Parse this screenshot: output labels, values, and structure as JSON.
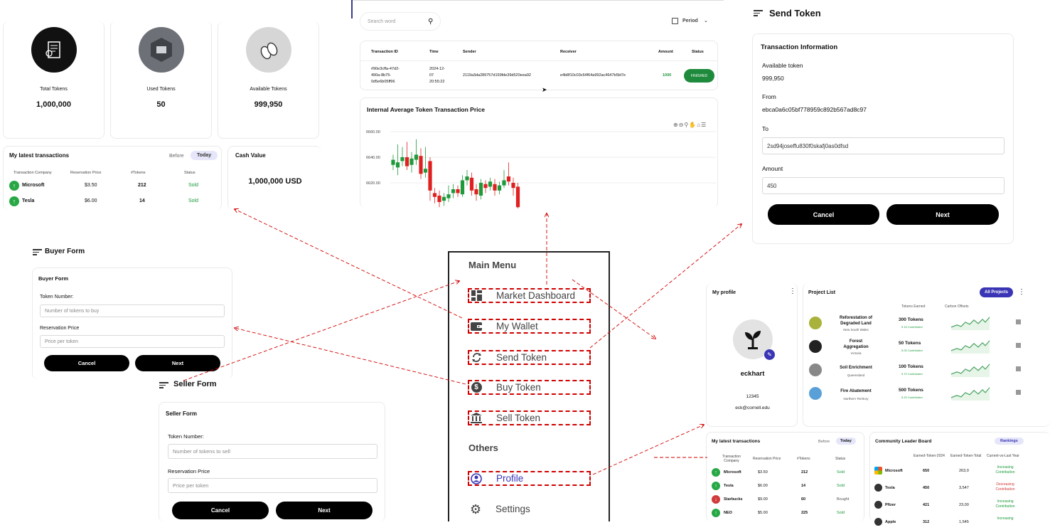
{
  "summary": {
    "tiles": [
      {
        "label": "Total Tokens",
        "value": "1,000,000"
      },
      {
        "label": "Used Tokens",
        "value": "50"
      },
      {
        "label": "Available Tokens",
        "value": "999,950"
      }
    ],
    "latest": {
      "title": "My latest transactions",
      "tabs": [
        "Before",
        "Today"
      ],
      "headers": [
        "Transaction Company",
        "Reservation Price",
        "#Tokens",
        "Status"
      ],
      "rows": [
        {
          "company": "Microsoft",
          "price": "$3.50",
          "tokens": "212",
          "status": "Sold"
        },
        {
          "company": "Tesla",
          "price": "$6.00",
          "tokens": "14",
          "status": "Sold"
        }
      ]
    },
    "cash": {
      "title": "Cash Value",
      "value": "1,000,000 USD"
    }
  },
  "market": {
    "search_placeholder": "Search word",
    "period_label": "Period",
    "table_headers": [
      "Transaction ID",
      "Time",
      "Sender",
      "Receiver",
      "Amount",
      "Status"
    ],
    "row": {
      "id": [
        "#90e3cffa-47d2-",
        "490a-8b75-",
        "0d5e6b05ff96"
      ],
      "time": [
        "2024-12-",
        "07",
        "20:55:22"
      ],
      "sender": "2119a3da289757d159fde39d520eea92",
      "receiver": "e4b8f10c03c64f64a992ac4647b5bl7e",
      "amount": "1000",
      "status": "FINISHED"
    },
    "chart_title": "Internal Average Token Transaction Price"
  },
  "chart_data": {
    "type": "candlestick",
    "title": "Internal Average Token Transaction Price",
    "y_ticks": [
      "6660.00",
      "6640.00",
      "6620.00"
    ],
    "ylim": [
      6600,
      6665
    ],
    "candles": [
      {
        "o": 6634,
        "c": 6638,
        "h": 6642,
        "l": 6630
      },
      {
        "o": 6632,
        "c": 6636,
        "h": 6650,
        "l": 6626
      },
      {
        "o": 6637,
        "c": 6640,
        "h": 6648,
        "l": 6633
      },
      {
        "o": 6640,
        "c": 6633,
        "h": 6652,
        "l": 6630
      },
      {
        "o": 6634,
        "c": 6639,
        "h": 6644,
        "l": 6628
      },
      {
        "o": 6638,
        "c": 6642,
        "h": 6654,
        "l": 6634
      },
      {
        "o": 6641,
        "c": 6627,
        "h": 6647,
        "l": 6623
      },
      {
        "o": 6628,
        "c": 6631,
        "h": 6648,
        "l": 6624
      },
      {
        "o": 6637,
        "c": 6614,
        "h": 6640,
        "l": 6606
      },
      {
        "o": 6612,
        "c": 6609,
        "h": 6616,
        "l": 6604
      },
      {
        "o": 6610,
        "c": 6605,
        "h": 6614,
        "l": 6601
      },
      {
        "o": 6606,
        "c": 6609,
        "h": 6612,
        "l": 6602
      },
      {
        "o": 6608,
        "c": 6611,
        "h": 6618,
        "l": 6605
      },
      {
        "o": 6612,
        "c": 6615,
        "h": 6619,
        "l": 6608
      },
      {
        "o": 6615,
        "c": 6612,
        "h": 6618,
        "l": 6609
      },
      {
        "o": 6611,
        "c": 6622,
        "h": 6626,
        "l": 6609
      },
      {
        "o": 6622,
        "c": 6625,
        "h": 6630,
        "l": 6618
      },
      {
        "o": 6624,
        "c": 6614,
        "h": 6628,
        "l": 6610
      },
      {
        "o": 6615,
        "c": 6611,
        "h": 6619,
        "l": 6606
      },
      {
        "o": 6610,
        "c": 6620,
        "h": 6623,
        "l": 6607
      },
      {
        "o": 6619,
        "c": 6616,
        "h": 6622,
        "l": 6612
      },
      {
        "o": 6617,
        "c": 6621,
        "h": 6624,
        "l": 6614
      },
      {
        "o": 6619,
        "c": 6614,
        "h": 6623,
        "l": 6610
      },
      {
        "o": 6614,
        "c": 6618,
        "h": 6621,
        "l": 6611
      },
      {
        "o": 6618,
        "c": 6622,
        "h": 6630,
        "l": 6616
      },
      {
        "o": 6625,
        "c": 6621,
        "h": 6636,
        "l": 6618
      },
      {
        "o": 6620,
        "c": 6616,
        "h": 6624,
        "l": 6610
      },
      {
        "o": 6617,
        "c": 6601,
        "h": 6620,
        "l": 6600
      }
    ]
  },
  "send": {
    "title": "Send Token",
    "section": "Transaction Information",
    "available_label": "Available token",
    "available_value": "999,950",
    "from_label": "From",
    "from_value": "ebca0a6c05bf778959c892b567ad8c97",
    "to_label": "To",
    "to_value": "2sd94joseffu830f0skafj0as0dfsd",
    "amount_label": "Amount",
    "amount_value": "450",
    "cancel": "Cancel",
    "next": "Next"
  },
  "buyer": {
    "title": "Buyer Form",
    "section": "Buyer Form",
    "token_label": "Token Number:",
    "token_placeholder": "Number of tokens to buy",
    "price_label": "Reservation Price",
    "price_placeholder": "Price per token",
    "cancel": "Cancel",
    "next": "Next"
  },
  "seller": {
    "title": "Seller Form",
    "section": "Seller Form",
    "token_label": "Token Number:",
    "token_placeholder": "Number of tokens to sell",
    "price_label": "Reservation Price",
    "price_placeholder": "Price per token",
    "cancel": "Cancel",
    "next": "Next"
  },
  "menu": {
    "main_title": "Main Menu",
    "items": [
      {
        "label": "Market Dashboard",
        "icon": "dashboard-icon"
      },
      {
        "label": "My Wallet",
        "icon": "wallet-icon"
      },
      {
        "label": "Send Token",
        "icon": "exchange-icon"
      },
      {
        "label": "Buy Token",
        "icon": "dollar-icon"
      },
      {
        "label": "Sell Token",
        "icon": "bank-icon"
      }
    ],
    "others_title": "Others",
    "profile": "Profile",
    "settings": "Settings"
  },
  "profile": {
    "title": "My profile",
    "name": "eckhart",
    "id": "12345",
    "email": "eck@cornell.edu",
    "projects_title": "Project List",
    "all_projects": "All Projects",
    "col_tokens": "Tokens Earned",
    "col_offsets": "Carbon Offsets",
    "projects": [
      {
        "name": [
          "Reforestation of",
          "Degraded Land"
        ],
        "region": "New South Wales",
        "tokens": "300 Tokens",
        "contrib": "5.15 Contributed"
      },
      {
        "name": [
          "Forest",
          "Aggregation"
        ],
        "region": "Victoria",
        "tokens": "50 Tokens",
        "contrib": "5.00 Contributed"
      },
      {
        "name": [
          "Soil Enrichment"
        ],
        "region": "Queensland",
        "tokens": "100 Tokens",
        "contrib": "5.70 Contributed"
      },
      {
        "name": [
          "Fire Abatement"
        ],
        "region": "Northern Territory",
        "tokens": "500 Tokens",
        "contrib": "5.20 Contributed"
      }
    ],
    "latest": {
      "title": "My latest transactions",
      "tabs": [
        "Before",
        "Today"
      ],
      "headers": [
        "Transaction Company",
        "Reservation Price",
        "#Tokens",
        "Status"
      ],
      "rows": [
        {
          "company": "Microsoft",
          "price": "$3.50",
          "tokens": "212",
          "status": "Sold"
        },
        {
          "company": "Tesla",
          "price": "$6.00",
          "tokens": "14",
          "status": "Sold"
        },
        {
          "company": "Starbucks",
          "price": "$9.00",
          "tokens": "60",
          "status": "Bought"
        },
        {
          "company": "NEO",
          "price": "$5.00",
          "tokens": "225",
          "status": "Sold"
        }
      ]
    },
    "leader": {
      "title": "Community Leader Board",
      "rankings": "Rankings",
      "headers": [
        "Earned-Token-2024",
        "Earned-Token-Total",
        "Current-vs-Last Year"
      ],
      "rows": [
        {
          "company": "Microsoft",
          "earned": "650",
          "total": "263,0",
          "trend": [
            "Increasing",
            "Contribution"
          ],
          "up": true
        },
        {
          "company": "Tesla",
          "earned": "450",
          "total": "3,547",
          "trend": [
            "Decreasing",
            "Contribution"
          ],
          "up": false
        },
        {
          "company": "Pfizer",
          "earned": "421",
          "total": "23,00",
          "trend": [
            "Increasing",
            "Contribution"
          ],
          "up": true
        },
        {
          "company": "Apple",
          "earned": "312",
          "total": "1,545",
          "trend": [
            "Increasing"
          ],
          "up": true
        }
      ]
    }
  }
}
